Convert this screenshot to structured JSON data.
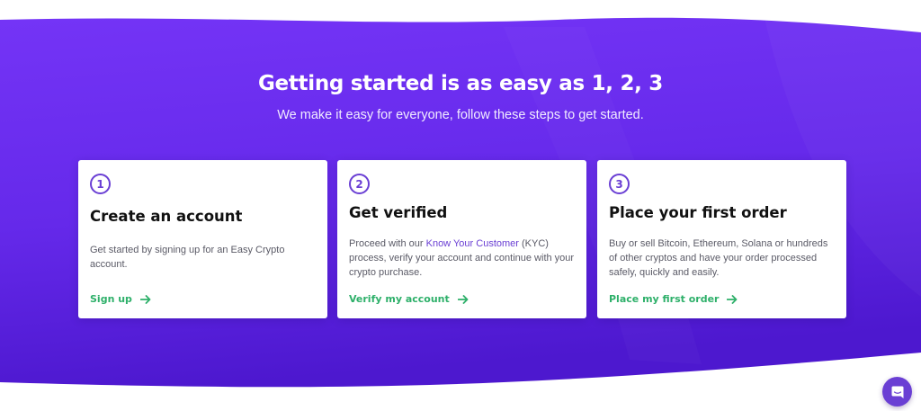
{
  "section": {
    "title": "Getting started is as easy as 1, 2, 3",
    "subtitle": "We make it easy for everyone, follow these steps to get started."
  },
  "steps": [
    {
      "number": "1",
      "title": "Create an account",
      "description": "Get started by signing up for an Easy Crypto account.",
      "action": "Sign up",
      "action_icon": "arrow-right-icon"
    },
    {
      "number": "2",
      "title": "Get verified",
      "description_before": "Proceed with our ",
      "description_link": "Know Your Customer",
      "description_after": " (KYC) process, verify your account and continue with your crypto purchase.",
      "action": "Verify my account",
      "action_icon": "arrow-right-icon"
    },
    {
      "number": "3",
      "title": "Place your first order",
      "description": "Buy or sell Bitcoin, Ethereum, Solana or hundreds of other cryptos and have your order processed safely, quickly and easily.",
      "action": "Place my first order",
      "action_icon": "arrow-right-icon"
    }
  ],
  "chat": {
    "icon": "chat-icon"
  },
  "colors": {
    "background_purple": "#6a2ff0",
    "card_background": "#ffffff",
    "accent_purple": "#6a3fd4",
    "action_green": "#2eb06a"
  }
}
